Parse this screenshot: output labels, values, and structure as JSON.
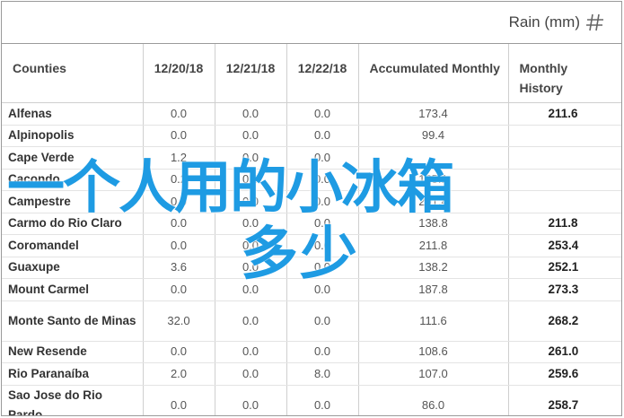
{
  "header": {
    "title": "Rain (mm)",
    "icon": "menu-icon"
  },
  "table": {
    "columns": [
      "Counties",
      "12/20/18",
      "12/21/18",
      "12/22/18",
      "Accumulated Monthly",
      "Monthly History"
    ],
    "rows": [
      [
        "Alfenas",
        "0.0",
        "0.0",
        "0.0",
        "173.4",
        "211.6"
      ],
      [
        "Alpinopolis",
        "0.0",
        "0.0",
        "0.0",
        "99.4",
        ""
      ],
      [
        "Cape Verde",
        "1.2",
        "0.0",
        "0.0",
        "",
        ""
      ],
      [
        "Cacondo",
        "0.2",
        "0.0",
        "0.0",
        "165.1",
        ""
      ],
      [
        "Campestre",
        "0.0",
        "0.0",
        "0.0",
        "201.4",
        ""
      ],
      [
        "Carmo do Rio Claro",
        "0.0",
        "0.0",
        "0.0",
        "138.8",
        "211.8"
      ],
      [
        "Coromandel",
        "0.0",
        "0.0",
        "0.0",
        "211.8",
        "253.4"
      ],
      [
        "Guaxupe",
        "3.6",
        "0.0",
        "0.0",
        "138.2",
        "252.1"
      ],
      [
        "Mount Carmel",
        "0.0",
        "0.0",
        "0.0",
        "187.8",
        "273.3"
      ],
      [
        "Monte Santo de Minas",
        "32.0",
        "0.0",
        "0.0",
        "111.6",
        "268.2"
      ],
      [
        "New Resende",
        "0.0",
        "0.0",
        "0.0",
        "108.6",
        "261.0"
      ],
      [
        "Rio Paranaíba",
        "2.0",
        "0.0",
        "8.0",
        "107.0",
        "259.6"
      ],
      [
        "Sao Jose do Rio Pardo",
        "0.0",
        "0.0",
        "0.0",
        "86.0",
        "258.7"
      ]
    ]
  },
  "overlay": {
    "line1": "一个人用的小冰箱",
    "line2": "多少",
    "color": "#1e9be3"
  }
}
